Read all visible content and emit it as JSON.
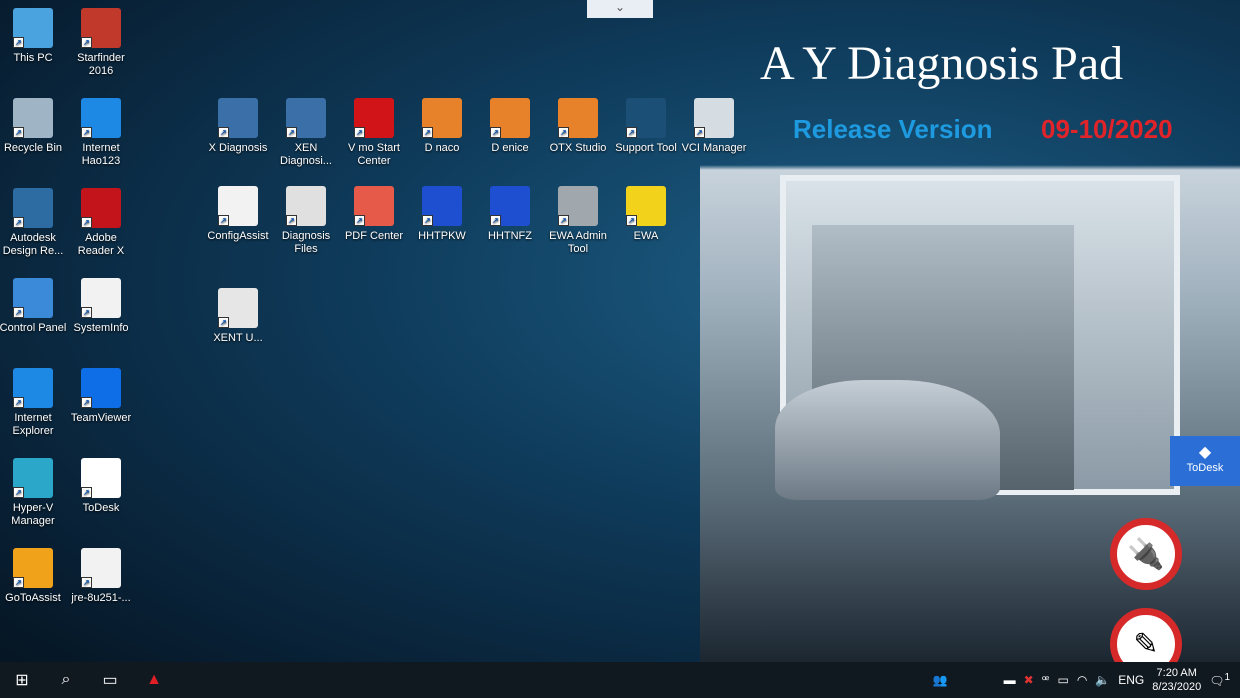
{
  "desktop_left": [
    {
      "label": "This PC",
      "icon": "computer-icon",
      "color": "#4aa3df"
    },
    {
      "label": "Starfinder 2016",
      "icon": "starfinder-icon",
      "color": "#c0392b"
    },
    {
      "label": "Recycle Bin",
      "icon": "recycle-bin-icon",
      "color": "#9fb4c4"
    },
    {
      "label": "Internet Hao123",
      "icon": "ie-icon",
      "color": "#1e88e5"
    },
    {
      "label": "Autodesk Design Re...",
      "icon": "autodesk-icon",
      "color": "#2d6ca2"
    },
    {
      "label": "Adobe Reader X",
      "icon": "adobe-reader-icon",
      "color": "#c4141b"
    },
    {
      "label": "Control Panel",
      "icon": "control-panel-icon",
      "color": "#3b8ad9"
    },
    {
      "label": "SystemInfo",
      "icon": "document-icon",
      "color": "#f2f2f2"
    },
    {
      "label": "Internet Explorer",
      "icon": "ie-icon",
      "color": "#1e88e5"
    },
    {
      "label": "TeamViewer",
      "icon": "teamviewer-icon",
      "color": "#0e6ee8"
    },
    {
      "label": "Hyper-V Manager",
      "icon": "hyperv-icon",
      "color": "#2aa7c9"
    },
    {
      "label": "ToDesk",
      "icon": "todesk-icon",
      "color": "#ffffff"
    },
    {
      "label": "GoToAssist",
      "icon": "gotoassist-icon",
      "color": "#f0a21a"
    },
    {
      "label": "jre-8u251-...",
      "icon": "java-icon",
      "color": "#f2f2f2"
    }
  ],
  "desktop_grid": [
    {
      "label": "X  Diagnosis",
      "icon": "xentry-icon",
      "color": "#3b6fa8"
    },
    {
      "label": "XEN  Diagnosi...",
      "icon": "xentry-diagnosis-icon",
      "color": "#3b6fa8"
    },
    {
      "label": "V   mo Start Center",
      "icon": "vediamo-icon",
      "color": "#d01418"
    },
    {
      "label": "D    naco",
      "icon": "monaco-icon",
      "color": "#e8822a"
    },
    {
      "label": "D   enice",
      "icon": "venice-icon",
      "color": "#e8822a"
    },
    {
      "label": "OTX Studio",
      "icon": "otx-studio-icon",
      "color": "#e8822a"
    },
    {
      "label": "Support Tool",
      "icon": "toolbox-icon",
      "color": "#1c4f75"
    },
    {
      "label": "VCI Manager",
      "icon": "vci-icon",
      "color": "#d5dde3"
    },
    {
      "label": "ConfigAssist",
      "icon": "gear-icon",
      "color": "#f2f2f2"
    },
    {
      "label": "Diagnosis Files",
      "icon": "files-icon",
      "color": "#e0e0e0"
    },
    {
      "label": "PDF Center",
      "icon": "pdf-icon",
      "color": "#e65a4a"
    },
    {
      "label": "HHTPKW",
      "icon": "remote-desktop-icon",
      "color": "#1f4fd1"
    },
    {
      "label": "HHTNFZ",
      "icon": "remote-desktop-icon",
      "color": "#1f4fd1"
    },
    {
      "label": "EWA Admin Tool",
      "icon": "wrench-icon",
      "color": "#a0a8ae"
    },
    {
      "label": "EWA",
      "icon": "ewa-icon",
      "color": "#f2d21a"
    },
    {
      "label": "XENT  U...",
      "icon": "xentry-update-icon",
      "color": "#e6e6e6"
    }
  ],
  "banner": {
    "title": "A    Y Diagnosis Pad",
    "release": "Release Version",
    "date": "09-10/2020"
  },
  "todesk_tab": {
    "label": "ToDesk"
  },
  "taskbar": {
    "lang": "ENG",
    "time": "7:20 AM",
    "date": "8/23/2020",
    "notifications": "1"
  }
}
